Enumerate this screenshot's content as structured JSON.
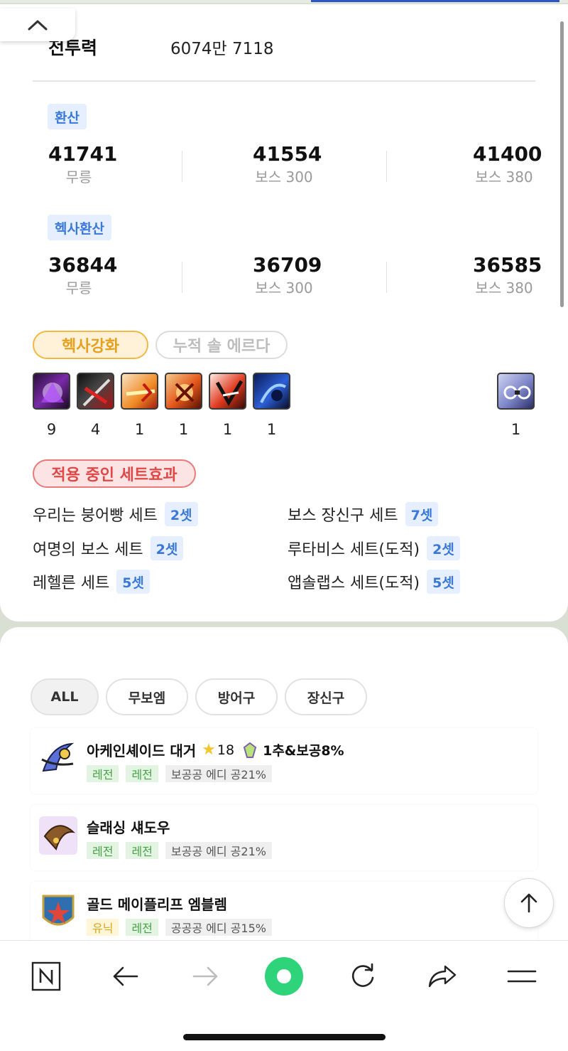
{
  "colors": {
    "accent_blue": "#3a78d8",
    "legend_green": "#46a146",
    "unique_yellow": "#d6a722",
    "hexa_orange": "#e6a020",
    "set_red": "#e04848",
    "naver_green": "#2fd37a"
  },
  "header": {
    "collapse_icon": "chevron-up-icon"
  },
  "combat_power": {
    "label": "전투력",
    "value": "6074만 7118"
  },
  "conversion": {
    "label": "환산",
    "stats": [
      {
        "value": "41741",
        "label": "무릉"
      },
      {
        "value": "41554",
        "label": "보스 300"
      },
      {
        "value": "41400",
        "label": "보스 380"
      }
    ]
  },
  "hexa_conversion": {
    "label": "헥사환산",
    "stats": [
      {
        "value": "36844",
        "label": "무릉"
      },
      {
        "value": "36709",
        "label": "보스 300"
      },
      {
        "value": "36585",
        "label": "보스 380"
      }
    ]
  },
  "tabs": {
    "hexa": "헥사강화",
    "sol_erda": "누적 솔 에르다"
  },
  "hexa_skills": {
    "counts": [
      "9",
      "4",
      "1",
      "1",
      "1",
      "1"
    ],
    "common_count": "1"
  },
  "set_effects": {
    "label": "적용 중인 세트효과",
    "items": [
      {
        "name": "우리는 붕어빵 세트",
        "count": "2셋"
      },
      {
        "name": "보스 장신구 세트",
        "count": "7셋"
      },
      {
        "name": "여명의 보스 세트",
        "count": "2셋"
      },
      {
        "name": "루타비스 세트(도적)",
        "count": "2셋"
      },
      {
        "name": "레헬른 세트",
        "count": "5셋"
      },
      {
        "name": "앱솔랩스 세트(도적)",
        "count": "5셋"
      }
    ]
  },
  "filters": [
    "ALL",
    "무보엠",
    "방어구",
    "장신구"
  ],
  "equipment": [
    {
      "name": "아케인셰이드 대거",
      "star": "18",
      "potential": "1추&보공8%",
      "tags": [
        "레전",
        "레전"
      ],
      "stat": "보공공 에디 공21%"
    },
    {
      "name": "슬래싱 섀도우",
      "tags": [
        "레전",
        "레전"
      ],
      "stat": "보공공 에디 공21%"
    },
    {
      "name": "골드 메이플리프 엠블렘",
      "tags": [
        "유닉",
        "레전"
      ],
      "stat": "공공공 에디 공15%"
    }
  ],
  "bottom_nav": [
    "naver-icon",
    "back-arrow-icon",
    "forward-arrow-icon",
    "home-circle-icon",
    "refresh-icon",
    "share-icon",
    "menu-icon"
  ]
}
